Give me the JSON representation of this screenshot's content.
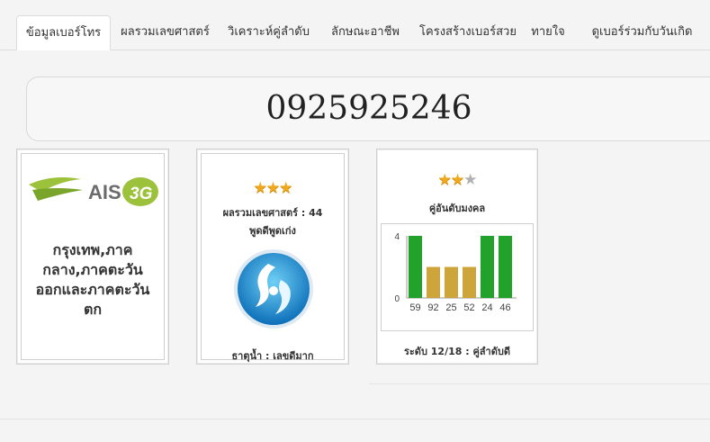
{
  "tabs": [
    {
      "label": "ข้อมูลเบอร์โทร",
      "active": true
    },
    {
      "label": "ผลรวมเลขศาสตร์",
      "active": false
    },
    {
      "label": "วิเคราะห์คู่ลำดับ",
      "active": false
    },
    {
      "label": "ลักษณะอาชีพ",
      "active": false
    },
    {
      "label": "โครงสร้างเบอร์สวย",
      "active": false
    },
    {
      "label": "ทายใจ",
      "active": false
    },
    {
      "label": "ดูเบอร์ร่วมกับวันเกิด",
      "active": false
    }
  ],
  "phone_number": "0925925246",
  "operator": {
    "logo_text": "AIS",
    "logo_badge": "3G",
    "region": "กรุงเทพ,ภาค กลาง,ภาคตะวัน ออกและภาคตะวัน ตก"
  },
  "numerology": {
    "stars_on": 3,
    "stars_total": 3,
    "sum_label": "ผลรวมเลขศาสตร์ : 44",
    "trait": "พูดดีพูดเก่ง",
    "element": "ธาตุน้ำ : เลขดีมาก",
    "icon": "water-element-icon"
  },
  "pairs": {
    "stars_on": 2,
    "stars_total": 3,
    "title": "คู่อันดับมงคล",
    "level": "ระดับ 12/18 : คู่ลำดับดี"
  },
  "chart_data": {
    "type": "bar",
    "categories": [
      "59",
      "92",
      "25",
      "52",
      "24",
      "46"
    ],
    "values": [
      4,
      2,
      2,
      2,
      4,
      4
    ],
    "colors": [
      "#22a22a",
      "#cda53a",
      "#cda53a",
      "#cda53a",
      "#22a22a",
      "#22a22a"
    ],
    "yticks": [
      "4",
      "0"
    ],
    "ylim": [
      0,
      4
    ]
  },
  "colors": {
    "good": "#22a22a",
    "medium": "#cda53a",
    "ais_green": "#7aa52b",
    "ais_gray": "#6b6b6b"
  }
}
